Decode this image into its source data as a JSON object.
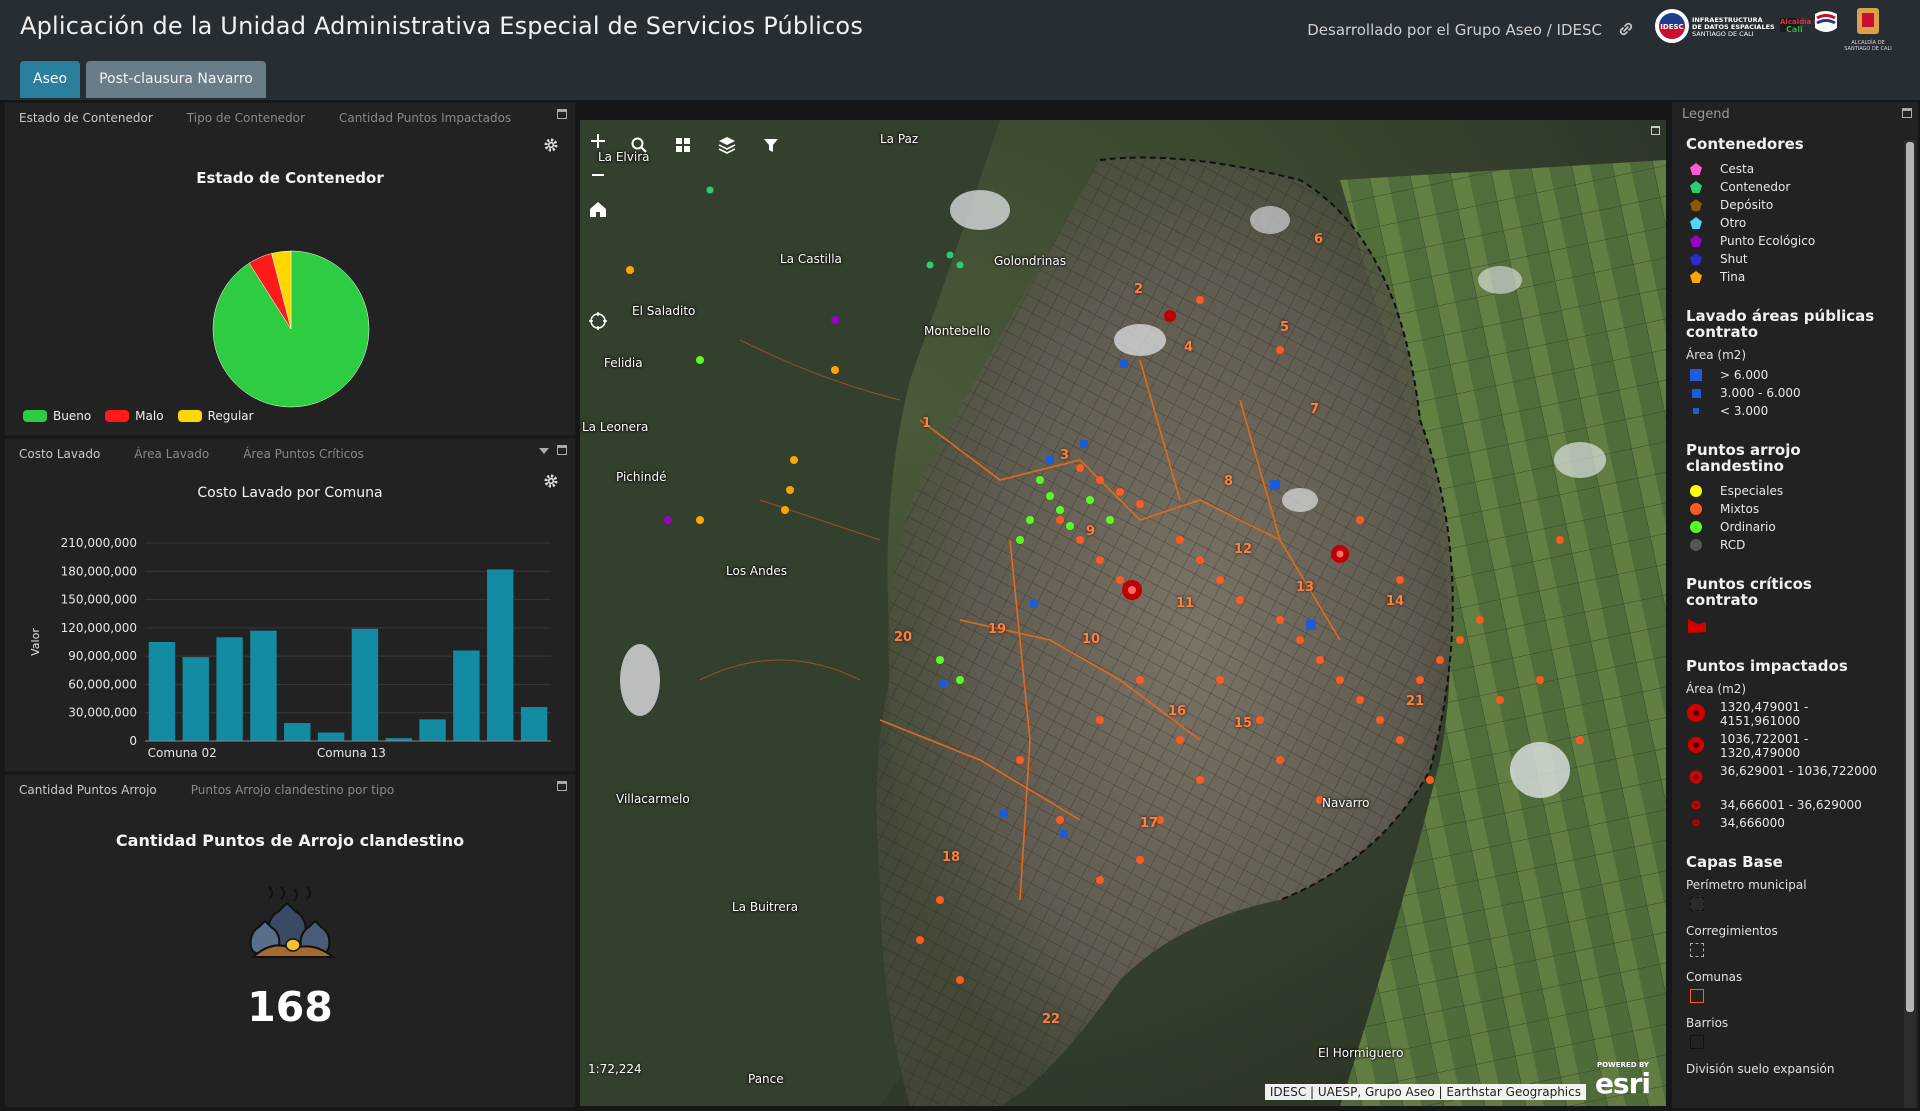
{
  "header": {
    "title": "Aplicación de la Unidad Administrativa Especial de Servicios Públicos",
    "credit": "Desarrollado por el Grupo Aseo / IDESC",
    "logo_text": "INFRAESTRUCTURA DE DATOS ESPACIALES SANTIAGO DE CALI"
  },
  "tabs": [
    {
      "label": "Aseo"
    },
    {
      "label": "Post-clausura Navarro"
    }
  ],
  "panel1": {
    "tabs": [
      "Estado de Contenedor",
      "Tipo de Contenedor",
      "Cantidad Puntos Impactados"
    ],
    "title": "Estado de Contenedor",
    "legend": [
      "Bueno",
      "Malo",
      "Regular"
    ],
    "chart_data": {
      "type": "pie",
      "title": "Estado de Contenedor",
      "labels": [
        "Bueno",
        "Malo",
        "Regular"
      ],
      "values": [
        91,
        5,
        4
      ],
      "colors": [
        "#2ecc40",
        "#ff1a1a",
        "#ffd700"
      ]
    }
  },
  "panel2": {
    "tabs": [
      "Costo Lavado",
      "Área Lavado",
      "Área Puntos Críticos"
    ],
    "title": "Costo Lavado por Comuna",
    "chart_data": {
      "type": "bar",
      "title": "Costo Lavado por Comuna",
      "ylabel": "Valor",
      "xlabel": "",
      "ylim": [
        0,
        210000000
      ],
      "yticks": [
        "0",
        "30,000,000",
        "60,000,000",
        "90,000,000",
        "120,000,000",
        "150,000,000",
        "180,000,000",
        "210,000,000"
      ],
      "xtick_labels": [
        "Comuna 02",
        "Comuna 13"
      ],
      "values": [
        105000000,
        89000000,
        110000000,
        117000000,
        19000000,
        9000000,
        119000000,
        3000000,
        23000000,
        96000000,
        182000000,
        36000000
      ],
      "color": "#138ba3"
    }
  },
  "panel3": {
    "tabs": [
      "Cantidad Puntos Arrojo",
      "Puntos Arrojo clandestino por tipo"
    ],
    "title": "Cantidad Puntos de Arrojo clandestino",
    "value": "168"
  },
  "map": {
    "scale": "1:72,224",
    "attribution": "IDESC | UAESP, Grupo Aseo | Earthstar Geographics",
    "brand_small": "POWERED BY",
    "brand": "esri",
    "places": [
      "La Paz",
      "La Elvira",
      "La Castilla",
      "Golondrinas",
      "El Saladito",
      "Montebello",
      "Felidia",
      "La Leonera",
      "Pichindé",
      "Los Andes",
      "Villacarmelo",
      "La Buitrera",
      "Pance",
      "Navarro",
      "El Hormiguero"
    ],
    "comunas": [
      "2",
      "6",
      "4",
      "5",
      "1",
      "7",
      "3",
      "8",
      "9",
      "12",
      "11",
      "14",
      "13",
      "20",
      "19",
      "10",
      "16",
      "21",
      "15",
      "17",
      "18",
      "22"
    ]
  },
  "legend": {
    "header": "Legend",
    "sections": {
      "contenedores": {
        "title": "Contenedores",
        "items": [
          {
            "label": "Cesta",
            "color": "#ff5ad0"
          },
          {
            "label": "Contenedor",
            "color": "#2ecc71"
          },
          {
            "label": "Depósito",
            "color": "#8b5a00"
          },
          {
            "label": "Otro",
            "color": "#4fd6ff"
          },
          {
            "label": "Punto Ecológico",
            "color": "#9b00c8"
          },
          {
            "label": "Shut",
            "color": "#2b2bd1"
          },
          {
            "label": "Tina",
            "color": "#ffa500"
          }
        ]
      },
      "lavado": {
        "title": "Lavado áreas públicas contrato",
        "sub": "Área (m2)",
        "items": [
          {
            "label": "> 6.000",
            "color": "#1e5bd6"
          },
          {
            "label": "3.000 - 6.000",
            "color": "#1e5bd6"
          },
          {
            "label": "< 3.000",
            "color": "#1e5bd6"
          }
        ]
      },
      "arrojo": {
        "title": "Puntos arrojo clandestino",
        "items": [
          {
            "label": "Especiales",
            "color": "#ffff00"
          },
          {
            "label": "Mixtos",
            "color": "#ff5a1f"
          },
          {
            "label": "Ordinario",
            "color": "#55ff22"
          },
          {
            "label": "RCD",
            "color": "#555555"
          }
        ]
      },
      "criticos": {
        "title": "Puntos críticos contrato",
        "color": "#d40000"
      },
      "impactados": {
        "title": "Puntos impactados",
        "sub": "Área (m2)",
        "items": [
          {
            "label": "1320,479001 - 4151,961000"
          },
          {
            "label": "1036,722001 - 1320,479000"
          },
          {
            "label": "36,629001 - 1036,722000"
          },
          {
            "label": "34,666001 - 36,629000"
          },
          {
            "label": "34,666000"
          }
        ]
      },
      "base": {
        "title": "Capas Base",
        "items": [
          {
            "label": "Perímetro municipal"
          },
          {
            "label": "Corregimientos"
          },
          {
            "label": "Comunas",
            "color": "#ff5a1f"
          },
          {
            "label": "Barrios"
          },
          {
            "label": "División suelo expansión"
          }
        ]
      }
    }
  }
}
